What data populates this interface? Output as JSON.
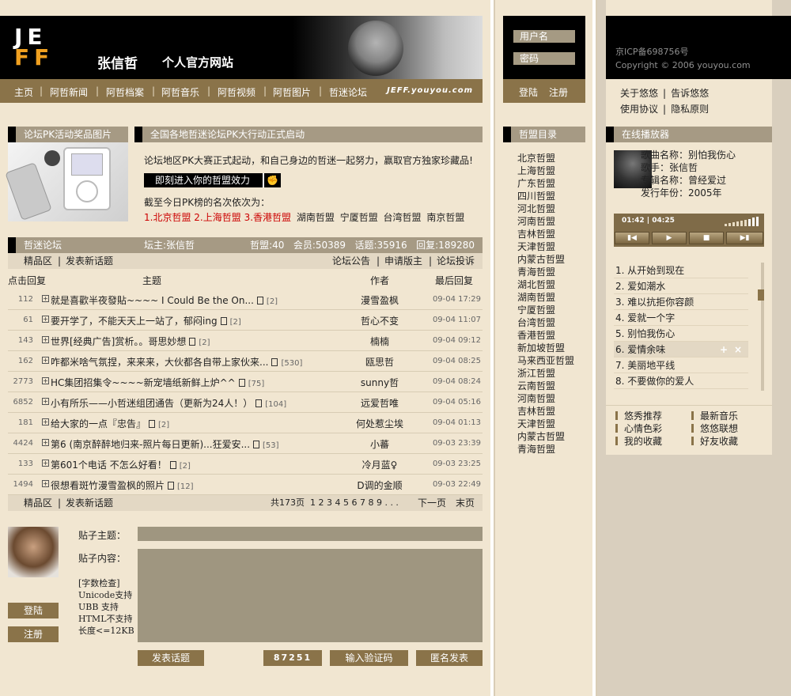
{
  "header": {
    "logo_top": "JE",
    "logo_bottom": "FF",
    "name": "张信哲",
    "subtitle": "个人官方网站",
    "domain": "JEFF.youyou.com"
  },
  "nav": [
    "主页",
    "阿哲新闻",
    "阿哲档案",
    "阿哲音乐",
    "阿哲视频",
    "阿哲图片",
    "哲迷论坛"
  ],
  "login": {
    "username": "用户名",
    "password": "密码",
    "login": "登陆",
    "register": "注册"
  },
  "icp": {
    "line1": "京ICP备698756号",
    "line2": "Copyright © 2006 youyou.com"
  },
  "right_links": [
    "关于悠悠",
    "告诉悠悠",
    "使用协议",
    "隐私原则"
  ],
  "prize": {
    "title": "论坛PK活动奖品图片"
  },
  "campaign": {
    "title": "全国各地哲迷论坛PK大行动正式启动",
    "desc": "论坛地区PK大赛正式起动，和自己身边的哲迷一起努力，赢取官方独家珍藏品!",
    "button": "即刻进入你的哲盟效力",
    "rank_label": "截至今日PK榜的名次依次为：",
    "ranks_top": [
      "1.北京哲盟",
      "2.上海哲盟",
      "3.香港哲盟"
    ],
    "ranks_rest": [
      "湖南哲盟",
      "宁厦哲盟",
      "台湾哲盟",
      "南京哲盟"
    ]
  },
  "forum": {
    "title": "哲迷论坛",
    "owner": "坛主:张信哲",
    "stats": "哲盟:40   会员:50389   话题:35916   回复:189280",
    "sub_left": [
      "精品区",
      "发表新话题"
    ],
    "sub_right": [
      "论坛公告",
      "申请版主",
      "论坛投诉"
    ],
    "cols": {
      "count": "点击回复",
      "title": "主题",
      "author": "作者",
      "last": "最后回复"
    },
    "rows": [
      {
        "count": "112",
        "title": "就是喜歡半夜發貼~~~~ I Could Be the On...",
        "pages": "[2]",
        "author": "漫雪盈枫",
        "date": "09-04 17:29"
      },
      {
        "count": "61",
        "title": "要开学了，不能天天上一站了，郁闷ing",
        "pages": "[2]",
        "author": "哲心不变",
        "date": "09-04 11:07"
      },
      {
        "count": "143",
        "title": "世界[经典广告]赏析。。哥思妙想",
        "pages": "[2]",
        "author": "楠楠",
        "date": "09-04 09:12"
      },
      {
        "count": "162",
        "title": "咋都米啥气氛捏，来来来，大伙都各自带上家伙来...",
        "pages": "[530]",
        "author": "瓯思哲",
        "date": "09-04 08:25"
      },
      {
        "count": "2773",
        "title": "HC集团招集令~~~~新宠墙纸新鲜上炉^^",
        "pages": "[75]",
        "author": "sunny哲",
        "date": "09-04 08:24"
      },
      {
        "count": "6852",
        "title": "小有所乐——小哲迷组团通告（更新为24人！）",
        "pages": "[104]",
        "author": "远爱哲唯",
        "date": "09-04 05:16"
      },
      {
        "count": "181",
        "title": "给大家的一点『忠告』",
        "pages": "[2]",
        "author": "何处惹尘埃",
        "date": "09-04 01:13"
      },
      {
        "count": "4424",
        "title": "第6 (南京醉醉地归来-照片每日更新)...狂爱安...",
        "pages": "[53]",
        "author": "小蕃",
        "date": "09-03 23:39"
      },
      {
        "count": "133",
        "title": "第601个电话 不怎么好看！",
        "pages": "[2]",
        "author": "冷月蓝♀",
        "date": "09-03 23:25"
      },
      {
        "count": "1494",
        "title": "很想看斑竹漫雪盈枫的照片",
        "pages": "[12]",
        "author": "D调的金顺",
        "date": "09-03 22:49"
      }
    ],
    "foot_left": [
      "精品区",
      "发表新话题"
    ],
    "pager": "共173页  1 2 3 4 5 6 7 8 9 . . .",
    "next": "下一页",
    "last": "末页"
  },
  "post": {
    "subject_label": "贴子主题：",
    "content_label": "贴子内容：",
    "login": "登陆",
    "register": "注册",
    "bb": [
      "[字数检查]",
      "Unicode支持",
      "UBB 支持",
      "HTML不支持",
      "长度<=12KB"
    ],
    "submit": "发表话题",
    "captcha": "87251",
    "captcha_btn": "输入验证码",
    "anon": "匿名发表"
  },
  "leagues": {
    "title": "哲盟目录",
    "items": [
      "北京哲盟",
      "上海哲盟",
      "广东哲盟",
      "四川哲盟",
      "河北哲盟",
      "河南哲盟",
      "吉林哲盟",
      "天津哲盟",
      "内蒙古哲盟",
      "青海哲盟",
      "湖北哲盟",
      "湖南哲盟",
      "宁厦哲盟",
      "台湾哲盟",
      "香港哲盟",
      "新加坡哲盟",
      "马来西亚哲盟",
      "浙江哲盟",
      "云南哲盟",
      "河南哲盟",
      "吉林哲盟",
      "天津哲盟",
      "内蒙古哲盟",
      "青海哲盟"
    ]
  },
  "player": {
    "title": "在线播放器",
    "song": "歌曲名称：别怕我伤心",
    "singer": "歌手：张信哲",
    "album": "专辑名称：曾经爱过",
    "year": "发行年份：2005年",
    "time": "01:42 | 04:25",
    "playlist": [
      "1. 从开始到现在",
      "2. 爱如潮水",
      "3. 难以抗拒你容颜",
      "4. 爱就一个字",
      "5. 别怕我伤心",
      "6. 爱情余味",
      "7. 美丽地平线",
      "8. 不要做你的爱人"
    ],
    "selected_index": 5
  },
  "bottom_links": [
    "悠秀推荐",
    "最新音乐",
    "心情色彩",
    "悠悠联想",
    "我的收藏",
    "好友收藏"
  ]
}
